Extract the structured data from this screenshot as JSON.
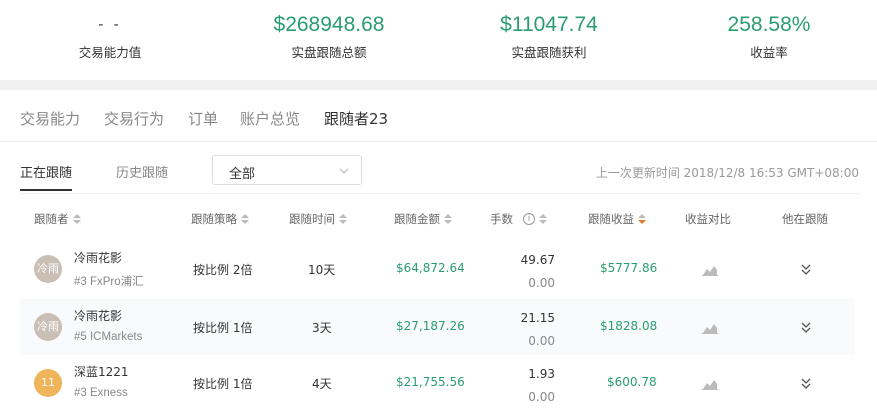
{
  "stats": [
    {
      "value": "- -",
      "label": "交易能力值"
    },
    {
      "value": "$268948.68",
      "label": "实盘跟随总额"
    },
    {
      "value": "$11047.74",
      "label": "实盘跟随获利"
    },
    {
      "value": "258.58%",
      "label": "收益率"
    }
  ],
  "tabs": [
    "交易能力",
    "交易行为",
    "订单",
    "账户总览",
    "跟随者23"
  ],
  "subtabs": [
    "正在跟随",
    "历史跟随"
  ],
  "filter": {
    "selected": "全部"
  },
  "updated": "上一次更新时间 2018/12/8 16:53 GMT+08:00",
  "columns": [
    "跟随者",
    "跟随策略",
    "跟随时间",
    "跟随金额",
    "手数",
    "跟随收益",
    "收益对比",
    "他在跟随"
  ],
  "rows": [
    {
      "avatar": "冷雨",
      "avatar_color": "#c9bfb5",
      "name": "冷雨花影",
      "broker": "#3 FxPro浦汇",
      "strategy": "按比例 2倍",
      "time": "10天",
      "amount": "$64,872.64",
      "lots": "49.67",
      "lots_sub": "0.00",
      "profit": "$5777.86"
    },
    {
      "avatar": "冷雨",
      "avatar_color": "#c9bfb5",
      "name": "冷雨花影",
      "broker": "#5 ICMarkets",
      "strategy": "按比例 1倍",
      "time": "3天",
      "amount": "$27,187.26",
      "lots": "21.15",
      "lots_sub": "0.00",
      "profit": "$1828.08"
    },
    {
      "avatar": "11",
      "avatar_color": "#f0b55a",
      "name": "深蓝1221",
      "broker": "#3 Exness",
      "strategy": "按比例 1倍",
      "time": "4天",
      "amount": "$21,755.56",
      "lots": "1.93",
      "lots_sub": "0.00",
      "profit": "$600.78"
    }
  ],
  "colors": {
    "accent_green": "#2a9d6f",
    "sort_active": "#e8782a"
  }
}
